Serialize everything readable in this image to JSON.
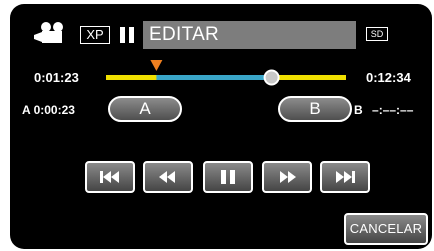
{
  "header": {
    "mode_badge": "XP",
    "title": "EDITAR",
    "media_badge": "SD"
  },
  "timeline": {
    "current_time": "0:01:23",
    "total_time": "0:12:34",
    "playhead_fraction": 0.69,
    "marker_a_fraction": 0.21,
    "colors": {
      "track": "#f0e000",
      "selection": "#3aa6c8",
      "marker": "#f08020"
    }
  },
  "ab_points": {
    "a_prefix": "A",
    "a_time": "0:00:23",
    "a_button_label": "A",
    "b_button_label": "B",
    "b_prefix": "B",
    "b_time": "–:––:––"
  },
  "controls": [
    "skip-back",
    "rewind",
    "pause",
    "fast-forward",
    "skip-forward"
  ],
  "footer": {
    "cancel_label": "CANCELAR"
  }
}
